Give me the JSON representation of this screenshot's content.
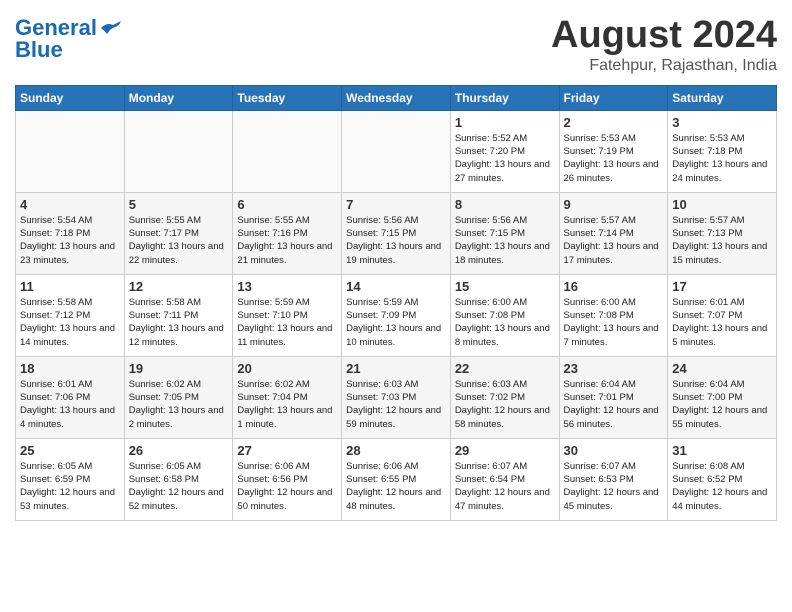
{
  "header": {
    "logo_line1": "General",
    "logo_line2": "Blue",
    "month": "August 2024",
    "location": "Fatehpur, Rajasthan, India"
  },
  "days_of_week": [
    "Sunday",
    "Monday",
    "Tuesday",
    "Wednesday",
    "Thursday",
    "Friday",
    "Saturday"
  ],
  "weeks": [
    [
      {
        "day": "",
        "text": ""
      },
      {
        "day": "",
        "text": ""
      },
      {
        "day": "",
        "text": ""
      },
      {
        "day": "",
        "text": ""
      },
      {
        "day": "1",
        "text": "Sunrise: 5:52 AM\nSunset: 7:20 PM\nDaylight: 13 hours\nand 27 minutes."
      },
      {
        "day": "2",
        "text": "Sunrise: 5:53 AM\nSunset: 7:19 PM\nDaylight: 13 hours\nand 26 minutes."
      },
      {
        "day": "3",
        "text": "Sunrise: 5:53 AM\nSunset: 7:18 PM\nDaylight: 13 hours\nand 24 minutes."
      }
    ],
    [
      {
        "day": "4",
        "text": "Sunrise: 5:54 AM\nSunset: 7:18 PM\nDaylight: 13 hours\nand 23 minutes."
      },
      {
        "day": "5",
        "text": "Sunrise: 5:55 AM\nSunset: 7:17 PM\nDaylight: 13 hours\nand 22 minutes."
      },
      {
        "day": "6",
        "text": "Sunrise: 5:55 AM\nSunset: 7:16 PM\nDaylight: 13 hours\nand 21 minutes."
      },
      {
        "day": "7",
        "text": "Sunrise: 5:56 AM\nSunset: 7:15 PM\nDaylight: 13 hours\nand 19 minutes."
      },
      {
        "day": "8",
        "text": "Sunrise: 5:56 AM\nSunset: 7:15 PM\nDaylight: 13 hours\nand 18 minutes."
      },
      {
        "day": "9",
        "text": "Sunrise: 5:57 AM\nSunset: 7:14 PM\nDaylight: 13 hours\nand 17 minutes."
      },
      {
        "day": "10",
        "text": "Sunrise: 5:57 AM\nSunset: 7:13 PM\nDaylight: 13 hours\nand 15 minutes."
      }
    ],
    [
      {
        "day": "11",
        "text": "Sunrise: 5:58 AM\nSunset: 7:12 PM\nDaylight: 13 hours\nand 14 minutes."
      },
      {
        "day": "12",
        "text": "Sunrise: 5:58 AM\nSunset: 7:11 PM\nDaylight: 13 hours\nand 12 minutes."
      },
      {
        "day": "13",
        "text": "Sunrise: 5:59 AM\nSunset: 7:10 PM\nDaylight: 13 hours\nand 11 minutes."
      },
      {
        "day": "14",
        "text": "Sunrise: 5:59 AM\nSunset: 7:09 PM\nDaylight: 13 hours\nand 10 minutes."
      },
      {
        "day": "15",
        "text": "Sunrise: 6:00 AM\nSunset: 7:08 PM\nDaylight: 13 hours\nand 8 minutes."
      },
      {
        "day": "16",
        "text": "Sunrise: 6:00 AM\nSunset: 7:08 PM\nDaylight: 13 hours\nand 7 minutes."
      },
      {
        "day": "17",
        "text": "Sunrise: 6:01 AM\nSunset: 7:07 PM\nDaylight: 13 hours\nand 5 minutes."
      }
    ],
    [
      {
        "day": "18",
        "text": "Sunrise: 6:01 AM\nSunset: 7:06 PM\nDaylight: 13 hours\nand 4 minutes."
      },
      {
        "day": "19",
        "text": "Sunrise: 6:02 AM\nSunset: 7:05 PM\nDaylight: 13 hours\nand 2 minutes."
      },
      {
        "day": "20",
        "text": "Sunrise: 6:02 AM\nSunset: 7:04 PM\nDaylight: 13 hours\nand 1 minute."
      },
      {
        "day": "21",
        "text": "Sunrise: 6:03 AM\nSunset: 7:03 PM\nDaylight: 12 hours\nand 59 minutes."
      },
      {
        "day": "22",
        "text": "Sunrise: 6:03 AM\nSunset: 7:02 PM\nDaylight: 12 hours\nand 58 minutes."
      },
      {
        "day": "23",
        "text": "Sunrise: 6:04 AM\nSunset: 7:01 PM\nDaylight: 12 hours\nand 56 minutes."
      },
      {
        "day": "24",
        "text": "Sunrise: 6:04 AM\nSunset: 7:00 PM\nDaylight: 12 hours\nand 55 minutes."
      }
    ],
    [
      {
        "day": "25",
        "text": "Sunrise: 6:05 AM\nSunset: 6:59 PM\nDaylight: 12 hours\nand 53 minutes."
      },
      {
        "day": "26",
        "text": "Sunrise: 6:05 AM\nSunset: 6:58 PM\nDaylight: 12 hours\nand 52 minutes."
      },
      {
        "day": "27",
        "text": "Sunrise: 6:06 AM\nSunset: 6:56 PM\nDaylight: 12 hours\nand 50 minutes."
      },
      {
        "day": "28",
        "text": "Sunrise: 6:06 AM\nSunset: 6:55 PM\nDaylight: 12 hours\nand 48 minutes."
      },
      {
        "day": "29",
        "text": "Sunrise: 6:07 AM\nSunset: 6:54 PM\nDaylight: 12 hours\nand 47 minutes."
      },
      {
        "day": "30",
        "text": "Sunrise: 6:07 AM\nSunset: 6:53 PM\nDaylight: 12 hours\nand 45 minutes."
      },
      {
        "day": "31",
        "text": "Sunrise: 6:08 AM\nSunset: 6:52 PM\nDaylight: 12 hours\nand 44 minutes."
      }
    ]
  ]
}
